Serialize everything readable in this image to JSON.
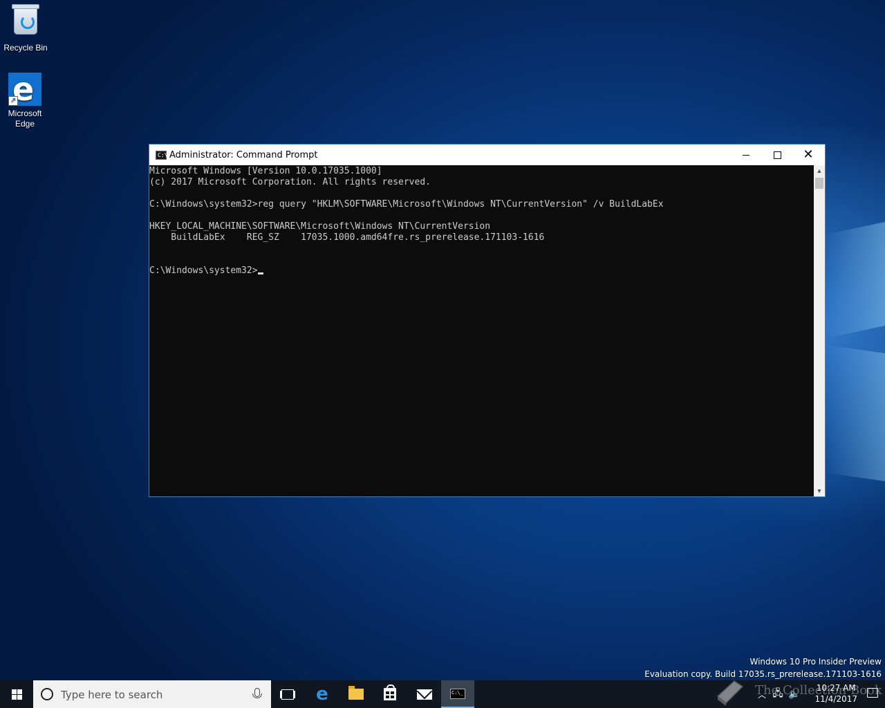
{
  "desktop": {
    "icons": [
      {
        "label": "Recycle Bin",
        "icon": "recycle-bin-icon"
      },
      {
        "label": "Microsoft Edge",
        "icon": "edge-icon"
      }
    ]
  },
  "window": {
    "title": "Administrator: Command Prompt",
    "controls": {
      "minimize": "minimize",
      "maximize": "maximize",
      "close": "close"
    },
    "console_lines": [
      "Microsoft Windows [Version 10.0.17035.1000]",
      "(c) 2017 Microsoft Corporation. All rights reserved.",
      "",
      "C:\\Windows\\system32>reg query \"HKLM\\SOFTWARE\\Microsoft\\Windows NT\\CurrentVersion\" /v BuildLabEx",
      "",
      "HKEY_LOCAL_MACHINE\\SOFTWARE\\Microsoft\\Windows NT\\CurrentVersion",
      "    BuildLabEx    REG_SZ    17035.1000.amd64fre.rs_prerelease.171103-1616",
      "",
      ""
    ],
    "prompt": "C:\\Windows\\system32>"
  },
  "watermark": {
    "line1": "Windows 10 Pro Insider Preview",
    "line2": "Evaluation copy. Build 17035.rs_prerelease.171103-1616"
  },
  "taskbar": {
    "search_placeholder": "Type here to search",
    "pinned": [
      "task-view-icon",
      "edge-icon",
      "file-explorer-icon",
      "store-icon",
      "mail-icon",
      "command-prompt-icon"
    ],
    "clock_time": "10:27 AM",
    "clock_date": "11/4/2017",
    "overlay_text": "The Collection Book"
  },
  "colors": {
    "accent": "#76b9ed",
    "console_bg": "#0c0c0c",
    "console_fg": "#cccccc",
    "taskbar_bg": "#101720"
  }
}
